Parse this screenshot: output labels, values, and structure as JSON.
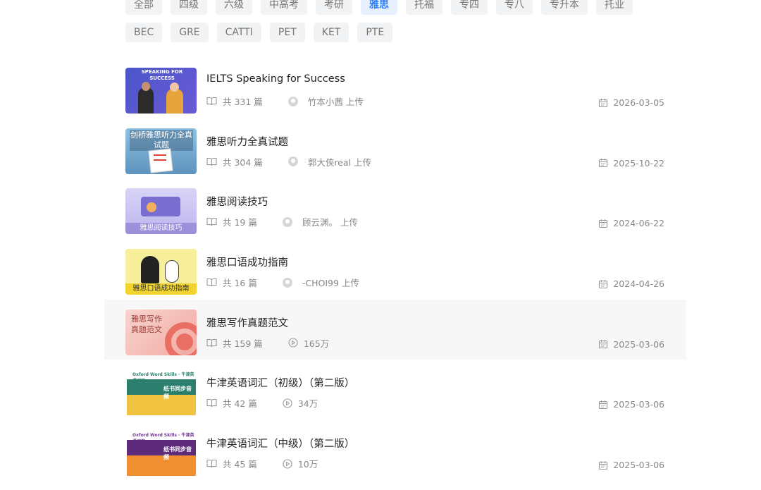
{
  "filters": {
    "row1": [
      "全部",
      "四级",
      "六级",
      "中高考",
      "考研",
      "雅思",
      "托福",
      "专四",
      "专八",
      "专升本",
      "托业"
    ],
    "row2": [
      "BEC",
      "GRE",
      "CATTI",
      "PET",
      "KET",
      "PTE"
    ],
    "active": "雅思"
  },
  "courses": [
    {
      "title": "IELTS Speaking for Success",
      "count": "共 331 篇",
      "meta": "竹本小茜 上传",
      "meta_type": "uploader",
      "date": "2026-03-05",
      "thumb_text": "SPEAKING FOR SUCCESS"
    },
    {
      "title": "雅思听力全真试题",
      "count": "共 304 篇",
      "meta": "郭大侠real 上传",
      "meta_type": "uploader",
      "date": "2025-10-22",
      "thumb_text": "剑桥雅思听力全真试题"
    },
    {
      "title": "雅思阅读技巧",
      "count": "共 19 篇",
      "meta": "顾云渊。 上传",
      "meta_type": "uploader",
      "date": "2024-06-22",
      "thumb_text": "雅思阅读技巧"
    },
    {
      "title": "雅思口语成功指南",
      "count": "共 16 篇",
      "meta": "-CHOI99 上传",
      "meta_type": "uploader",
      "date": "2024-04-26",
      "thumb_text": "雅思口语成功指南"
    },
    {
      "title": "雅思写作真题范文",
      "count": "共 159 篇",
      "meta": "165万",
      "meta_type": "plays",
      "date": "2025-03-06",
      "thumb_text": "雅思写作真题范文"
    },
    {
      "title": "牛津英语词汇（初级）（第二版）",
      "count": "共 42 篇",
      "meta": "34万",
      "meta_type": "plays",
      "date": "2025-03-06",
      "thumb_text": "牛津英语词汇"
    },
    {
      "title": "牛津英语词汇（中级）（第二版）",
      "count": "共 45 篇",
      "meta": "10万",
      "meta_type": "plays",
      "date": "2025-03-06",
      "thumb_text": "牛津英语词汇"
    }
  ],
  "hovered_index": 4
}
